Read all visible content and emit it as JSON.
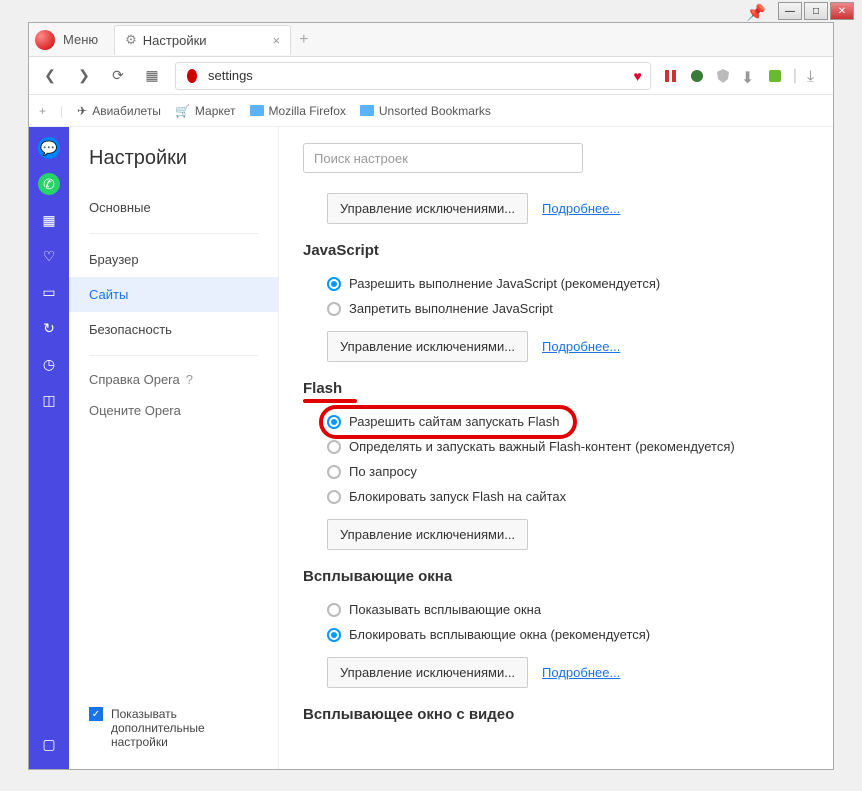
{
  "window": {
    "menu_label": "Меню",
    "tab_title": "Настройки",
    "address": "settings"
  },
  "bookmarks": {
    "b1": "Авиабилеты",
    "b2": "Маркет",
    "b3": "Mozilla Firefox",
    "b4": "Unsorted Bookmarks"
  },
  "sidebar": {
    "title": "Настройки",
    "items": {
      "basic": "Основные",
      "browser": "Браузер",
      "sites": "Сайты",
      "security": "Безопасность"
    },
    "help": "Справка Opera",
    "rate": "Оцените Opera",
    "advanced": "Показывать дополнительные настройки"
  },
  "search": {
    "placeholder": "Поиск настроек"
  },
  "exceptions_btn": "Управление исключениями...",
  "more_link": "Подробнее...",
  "js": {
    "heading": "JavaScript",
    "allow": "Разрешить выполнение JavaScript (рекомендуется)",
    "block": "Запретить выполнение JavaScript"
  },
  "flash": {
    "heading": "Flash",
    "allow": "Разрешить сайтам запускать Flash",
    "detect": "Определять и запускать важный Flash-контент (рекомендуется)",
    "ask": "По запросу",
    "block": "Блокировать запуск Flash на сайтах"
  },
  "popups": {
    "heading": "Всплывающие окна",
    "show": "Показывать всплывающие окна",
    "block": "Блокировать всплывающие окна (рекомендуется)"
  },
  "videopop": {
    "heading": "Всплывающее окно с видео"
  }
}
